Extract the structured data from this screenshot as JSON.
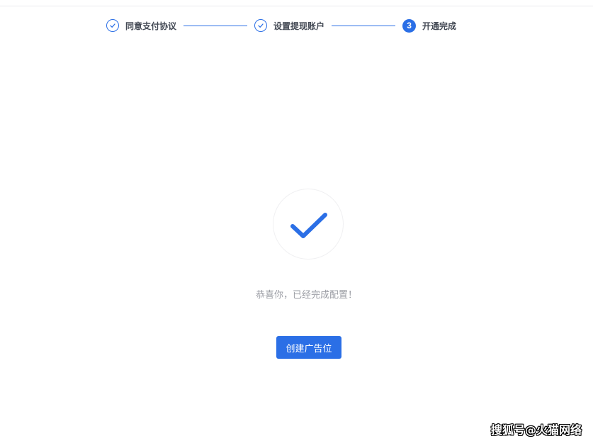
{
  "steps": [
    {
      "label": "同意支付协议",
      "state": "done",
      "icon": "check-icon"
    },
    {
      "label": "设置提现账户",
      "state": "done",
      "icon": "check-icon"
    },
    {
      "label": "开通完成",
      "state": "current",
      "number": "3"
    }
  ],
  "colors": {
    "accent": "#2b6fe6",
    "muted_text": "#9a9ca3",
    "step_text": "#444a55"
  },
  "success": {
    "icon": "large-check-icon",
    "message": "恭喜你，已经完成配置！"
  },
  "actions": {
    "create_label": "创建广告位"
  },
  "watermark": "搜狐号@火猫网络"
}
